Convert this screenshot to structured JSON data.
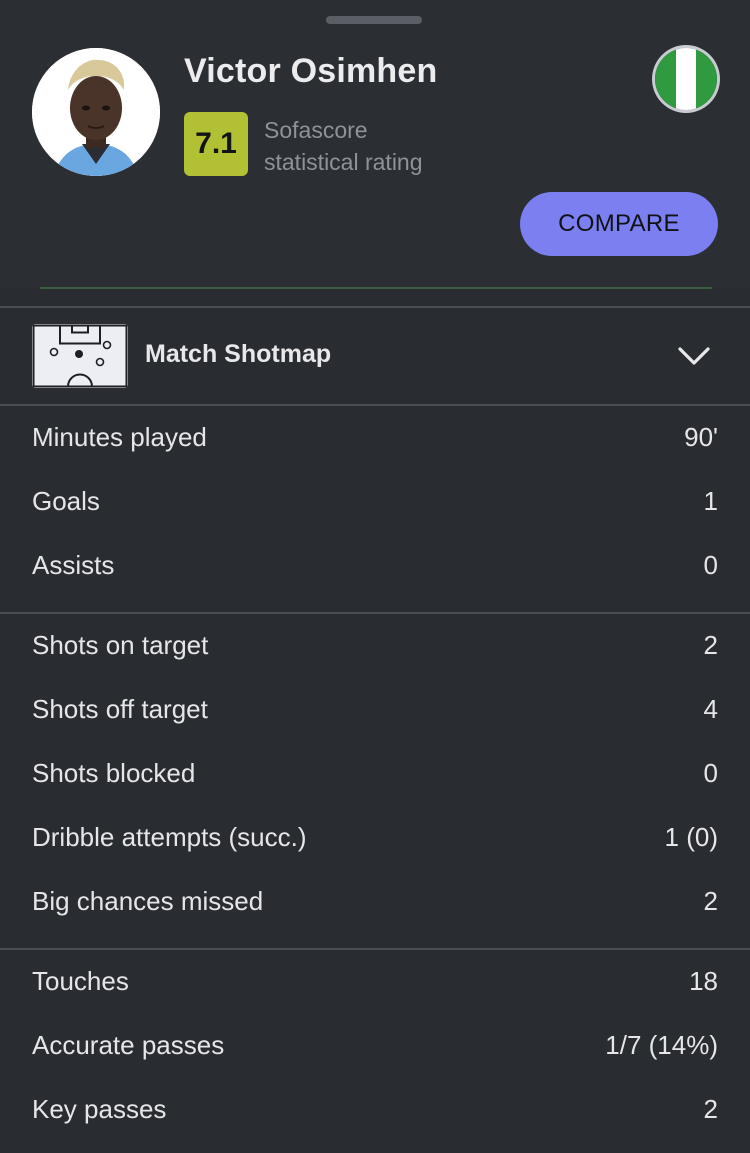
{
  "player": {
    "name": "Victor Osimhen",
    "rating": "7.1",
    "rating_label_line1": "Sofascore",
    "rating_label_line2": "statistical rating",
    "rating_color": "#b2c033",
    "flag_icon": "nigeria-flag"
  },
  "actions": {
    "compare_label": "COMPARE",
    "compare_color": "#7b7ff0"
  },
  "shotmap": {
    "title": "Match Shotmap",
    "icon": "pitch-shotmap-icon",
    "toggle_icon": "chevron-down-icon"
  },
  "stats": {
    "group1": [
      {
        "label": "Minutes played",
        "value": "90'"
      },
      {
        "label": "Goals",
        "value": "1"
      },
      {
        "label": "Assists",
        "value": "0"
      }
    ],
    "group2": [
      {
        "label": "Shots on target",
        "value": "2"
      },
      {
        "label": "Shots off target",
        "value": "4"
      },
      {
        "label": "Shots blocked",
        "value": "0"
      },
      {
        "label": "Dribble attempts (succ.)",
        "value": "1 (0)"
      },
      {
        "label": "Big chances missed",
        "value": "2"
      }
    ],
    "group3": [
      {
        "label": "Touches",
        "value": "18"
      },
      {
        "label": "Accurate passes",
        "value": "1/7 (14%)"
      },
      {
        "label": "Key passes",
        "value": "2"
      }
    ]
  },
  "theme": {
    "background": "#292c31",
    "divider": "#4a4d53",
    "text": "#e6e6e8",
    "muted": "#8f9298"
  }
}
